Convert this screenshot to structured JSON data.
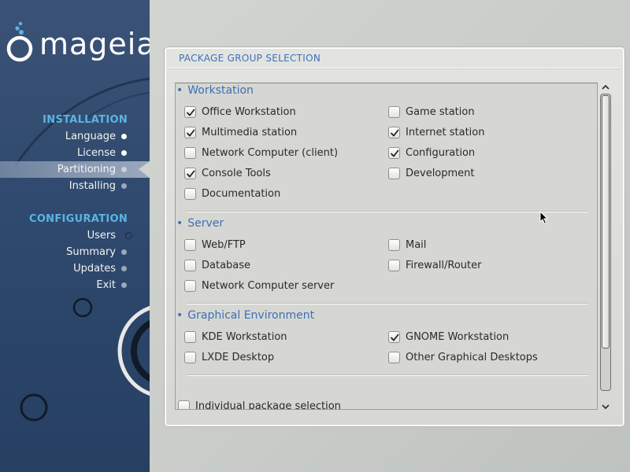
{
  "sidebar": {
    "logo_text": "mageia",
    "sections": [
      {
        "title": "INSTALLATION"
      },
      {
        "title": "CONFIGURATION"
      }
    ],
    "installation_steps": [
      {
        "label": "Language",
        "state": "done"
      },
      {
        "label": "License",
        "state": "done"
      },
      {
        "label": "Partitioning",
        "state": "current"
      },
      {
        "label": "Installing",
        "state": "todo"
      }
    ],
    "configuration_steps": [
      {
        "label": "Users",
        "state": "ring"
      },
      {
        "label": "Summary",
        "state": "todo"
      },
      {
        "label": "Updates",
        "state": "todo"
      },
      {
        "label": "Exit",
        "state": "todo"
      }
    ]
  },
  "panel": {
    "title": "PACKAGE GROUP SELECTION",
    "groups": [
      {
        "title": "Workstation",
        "options": [
          {
            "label": "Office Workstation",
            "checked": true
          },
          {
            "label": "Game station",
            "checked": false
          },
          {
            "label": "Multimedia station",
            "checked": true
          },
          {
            "label": "Internet station",
            "checked": true
          },
          {
            "label": "Network Computer (client)",
            "checked": false
          },
          {
            "label": "Configuration",
            "checked": true
          },
          {
            "label": "Console Tools",
            "checked": true
          },
          {
            "label": "Development",
            "checked": false
          },
          {
            "label": "Documentation",
            "checked": false
          }
        ]
      },
      {
        "title": "Server",
        "options": [
          {
            "label": "Web/FTP",
            "checked": false
          },
          {
            "label": "Mail",
            "checked": false
          },
          {
            "label": "Database",
            "checked": false
          },
          {
            "label": "Firewall/Router",
            "checked": false
          },
          {
            "label": "Network Computer server",
            "checked": false
          }
        ]
      },
      {
        "title": "Graphical Environment",
        "options": [
          {
            "label": "KDE Workstation",
            "checked": false
          },
          {
            "label": "GNOME Workstation",
            "checked": true
          },
          {
            "label": "LXDE Desktop",
            "checked": false
          },
          {
            "label": "Other Graphical Desktops",
            "checked": false
          }
        ]
      }
    ],
    "individual_selection": {
      "label": "Individual package selection",
      "checked": false
    }
  },
  "colors": {
    "sidebar_bg": "#2f4a6e",
    "section_title": "#5ab4e6",
    "group_title": "#3d6fb5",
    "panel_bg": "#dcddd9"
  }
}
